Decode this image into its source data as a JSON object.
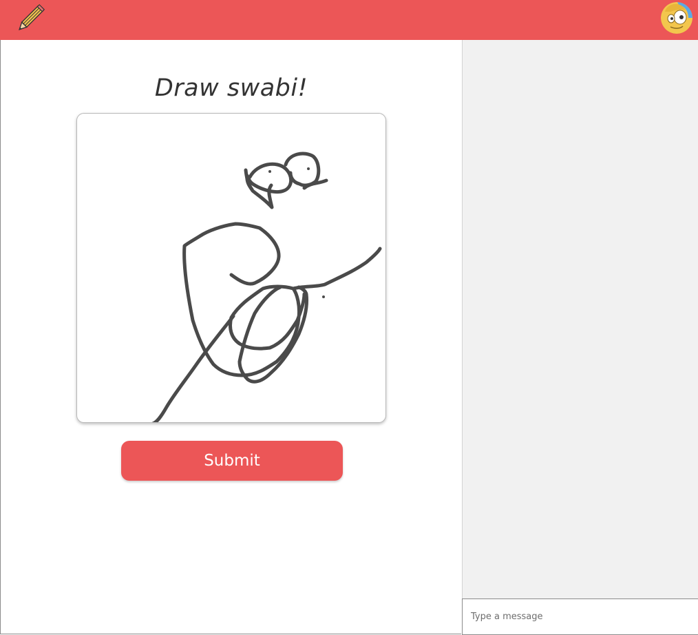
{
  "header": {
    "logo_icon": "pencil-icon",
    "avatar_icon": "user-avatar-icon",
    "color": "#ec5657"
  },
  "game": {
    "prompt": "Draw swabi!",
    "submit_label": "Submit",
    "stroke_color": "#4a4a4a"
  },
  "chat": {
    "placeholder": "Type a message",
    "value": ""
  }
}
